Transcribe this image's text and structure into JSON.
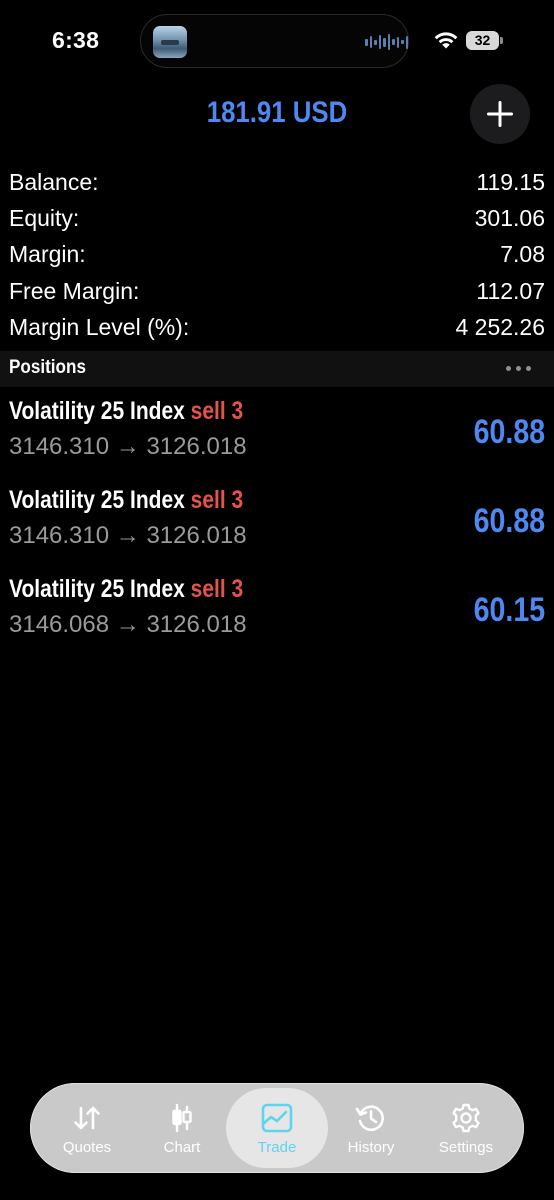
{
  "status_bar": {
    "time": "6:38",
    "battery": "32"
  },
  "header": {
    "total": "181.91 USD"
  },
  "account": [
    {
      "label": "Balance:",
      "value": "119.15"
    },
    {
      "label": "Equity:",
      "value": "301.06"
    },
    {
      "label": "Margin:",
      "value": "7.08"
    },
    {
      "label": "Free Margin:",
      "value": "112.07"
    },
    {
      "label": "Margin Level (%):",
      "value": "4 252.26"
    }
  ],
  "positions": {
    "title": "Positions",
    "items": [
      {
        "symbol": "Volatility 25 Index",
        "side": "sell 3",
        "prices": "3146.310 → 3126.018",
        "profit": "60.88"
      },
      {
        "symbol": "Volatility 25 Index",
        "side": "sell 3",
        "prices": "3146.310 → 3126.018",
        "profit": "60.88"
      },
      {
        "symbol": "Volatility 25 Index",
        "side": "sell 3",
        "prices": "3146.068 → 3126.018",
        "profit": "60.15"
      }
    ]
  },
  "tabbar": {
    "tabs": [
      {
        "label": "Quotes",
        "icon": "quotes-arrows-icon"
      },
      {
        "label": "Chart",
        "icon": "candlestick-chart-icon"
      },
      {
        "label": "Trade",
        "icon": "trade-icon",
        "active": true
      },
      {
        "label": "History",
        "icon": "history-clock-icon"
      },
      {
        "label": "Settings",
        "icon": "gear-icon"
      }
    ]
  },
  "colors": {
    "accent_blue": "#4f88f0",
    "sell_red": "#e5534b",
    "active_tab": "#5fd3ef"
  }
}
